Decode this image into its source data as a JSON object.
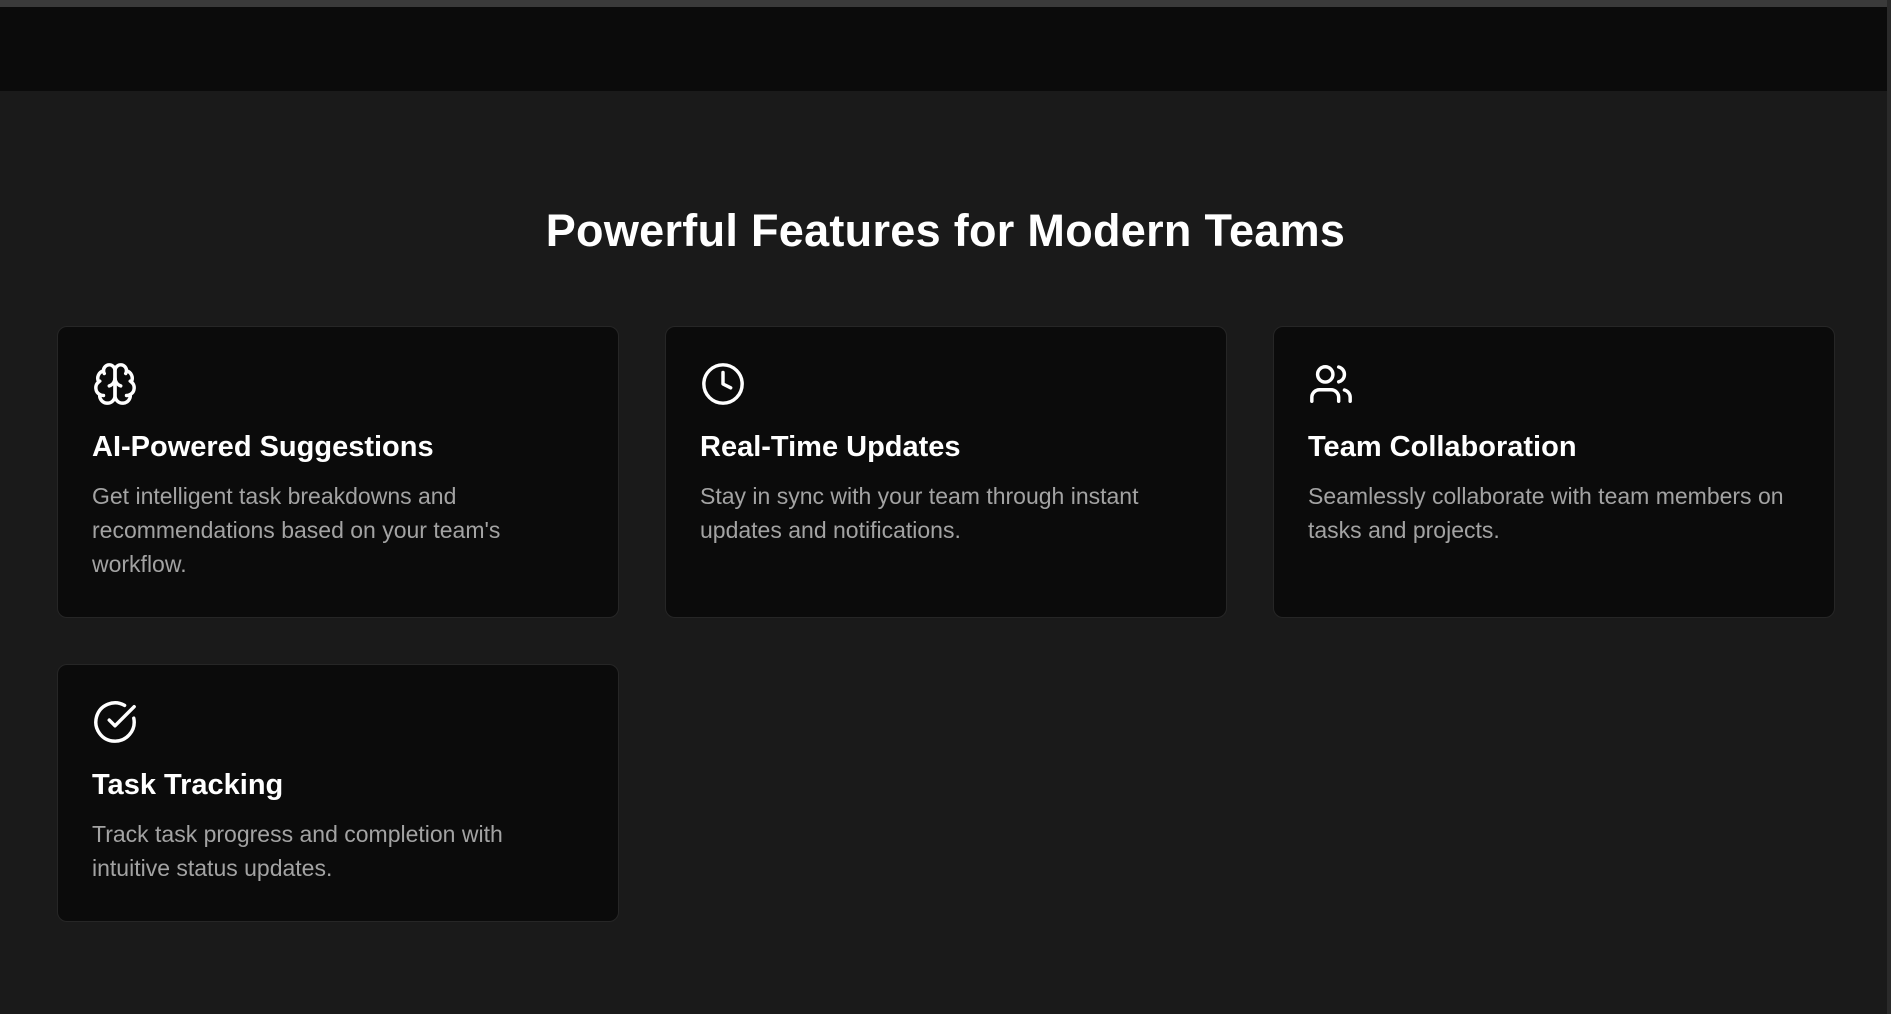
{
  "features": {
    "title": "Powerful Features for Modern Teams",
    "cards": [
      {
        "icon": "brain-icon",
        "title": "AI-Powered Suggestions",
        "description": "Get intelligent task breakdowns and recommendations based on your team's workflow."
      },
      {
        "icon": "clock-icon",
        "title": "Real-Time Updates",
        "description": "Stay in sync with your team through instant updates and notifications."
      },
      {
        "icon": "users-icon",
        "title": "Team Collaboration",
        "description": "Seamlessly collaborate with team members on tasks and projects."
      },
      {
        "icon": "check-circle-icon",
        "title": "Task Tracking",
        "description": "Track task progress and completion with intuitive status updates."
      }
    ]
  },
  "colors": {
    "page_background": "#1a1a1a",
    "card_background": "#0b0b0b",
    "heading_text": "#ffffff",
    "body_text": "#a3a3a3"
  }
}
